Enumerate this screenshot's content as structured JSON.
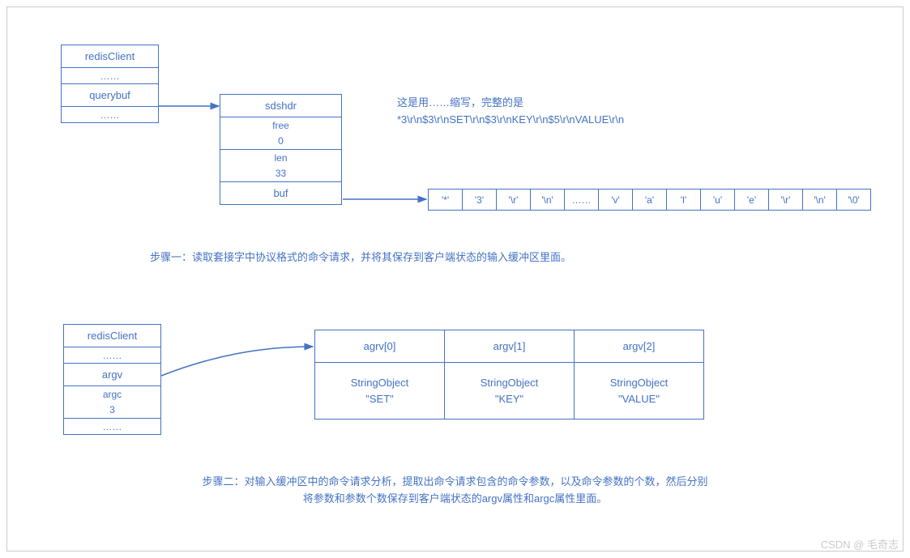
{
  "redisClient1": {
    "title": "redisClient",
    "dots1": "……",
    "field": "querybuf",
    "dots2": "……"
  },
  "sdshdr": {
    "title": "sdshdr",
    "free_label": "free",
    "free_value": "0",
    "len_label": "len",
    "len_value": "33",
    "buf_label": "buf"
  },
  "explain": {
    "line1": "这是用……缩写，完整的是",
    "line2": "*3\\r\\n$3\\r\\nSET\\r\\n$3\\r\\nKEY\\r\\n$5\\r\\nVALUE\\r\\n"
  },
  "buf_cells": [
    "'*'",
    "'3'",
    "'\\r'",
    "'\\n'",
    "……",
    "'v'",
    "'a'",
    "'l'",
    "'u'",
    "'e'",
    "'\\r'",
    "'\\n'",
    "'\\0'"
  ],
  "step1": "步骤一：读取套接字中协议格式的命令请求，并将其保存到客户端状态的输入缓冲区里面。",
  "redisClient2": {
    "title": "redisClient",
    "dots1": "……",
    "field1": "argv",
    "field2_label": "argc",
    "field2_value": "3",
    "dots2": "……"
  },
  "argv": {
    "headers": [
      "agrv[0]",
      "argv[1]",
      "argv[2]"
    ],
    "body_obj": "StringObject",
    "body_vals": [
      "\"SET\"",
      "\"KEY\"",
      "\"VALUE\""
    ]
  },
  "step2_line1": "步骤二：对输入缓冲区中的命令请求分析，提取出命令请求包含的命令参数，以及命令参数的个数，然后分别",
  "step2_line2": "将参数和参数个数保存到客户端状态的argv属性和argc属性里面。",
  "watermark": "CSDN @ 毛奇志"
}
